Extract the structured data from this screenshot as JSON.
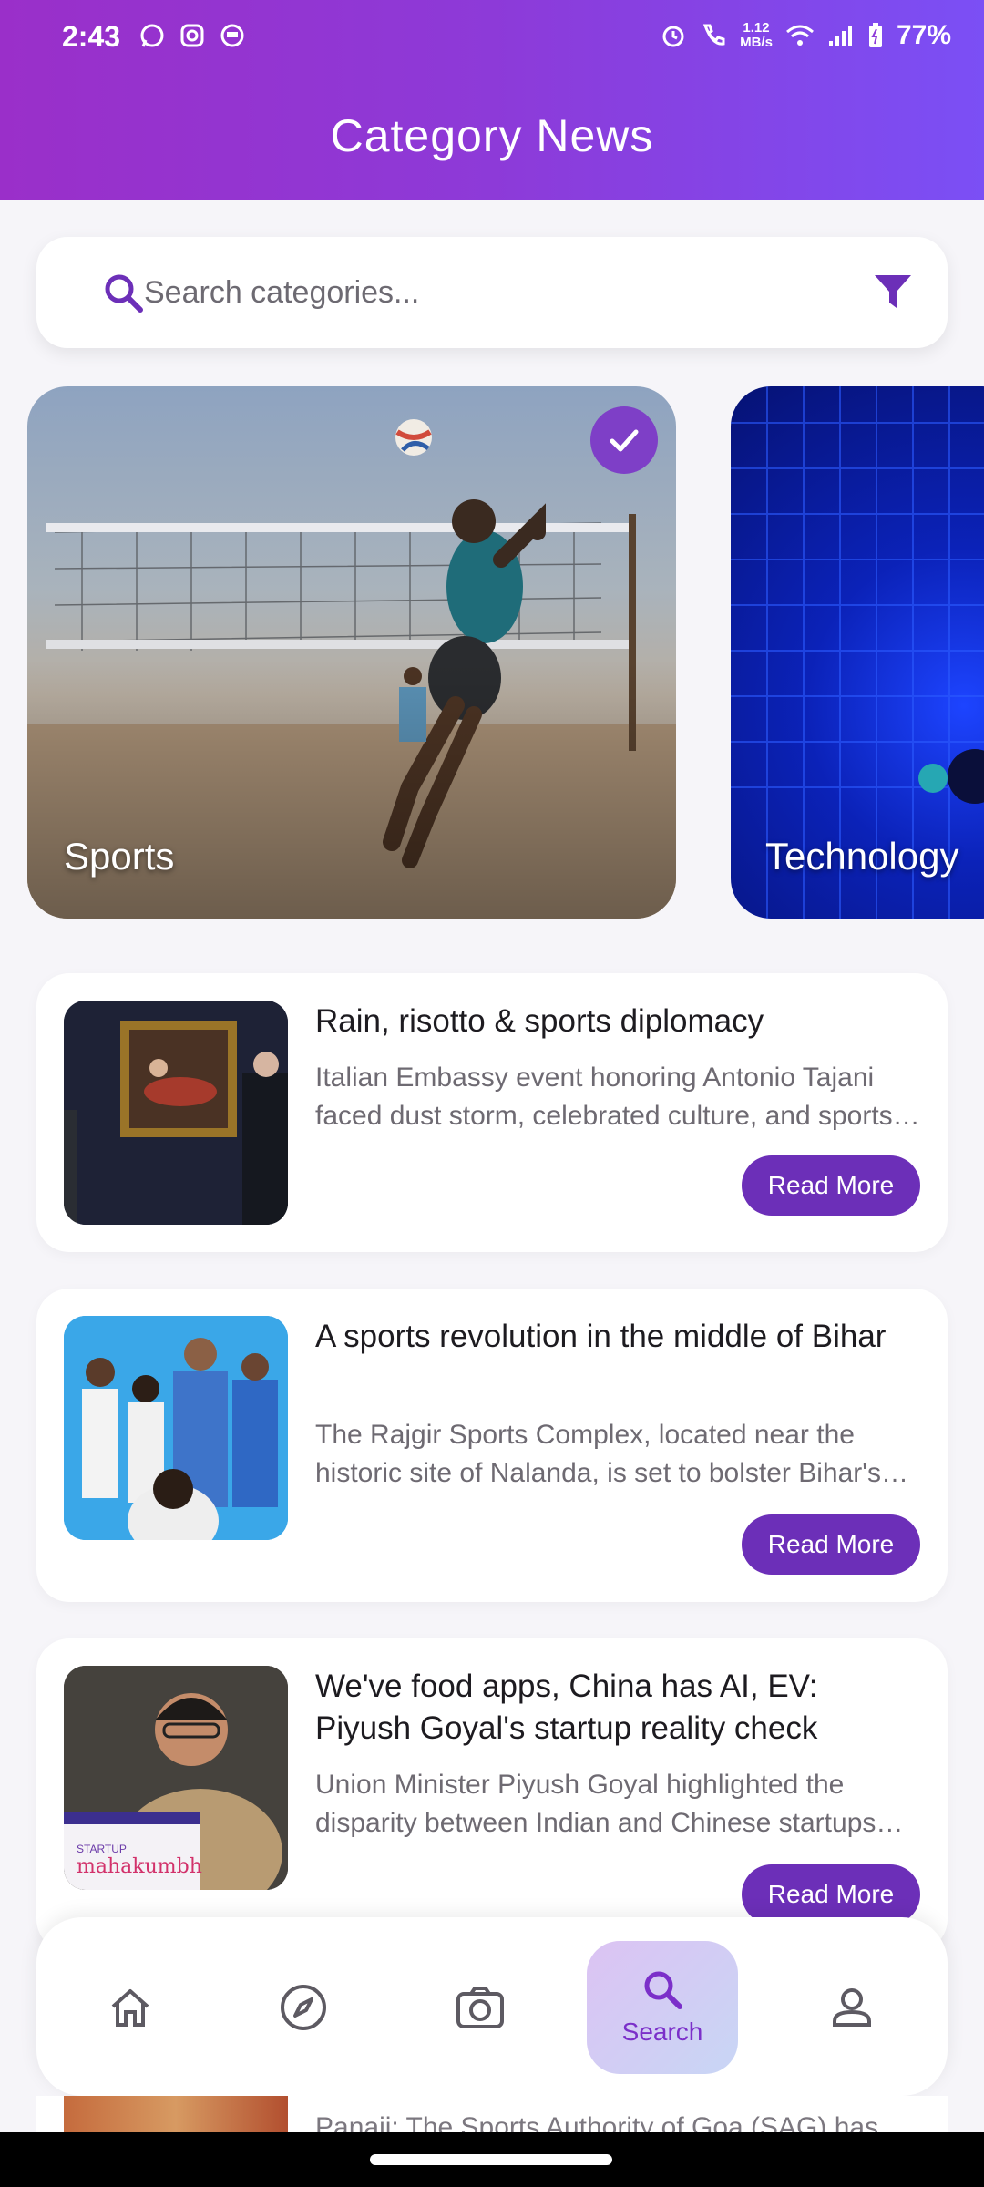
{
  "status_bar": {
    "time": "2:43",
    "speed_top": "1.12",
    "speed_bottom": "MB/s",
    "battery": "77%"
  },
  "header": {
    "title": "Category News"
  },
  "search": {
    "placeholder": "Search categories..."
  },
  "categories": [
    {
      "label": "Sports",
      "selected": true
    },
    {
      "label": "Technology",
      "selected": false
    }
  ],
  "articles": [
    {
      "title": "Rain, risotto & sports diplomacy",
      "description": "Italian Embassy event honoring Antonio Tajani faced dust storm, celebrated culture, and sports diplomacy.",
      "button": "Read More"
    },
    {
      "title": "A sports revolution in the middle of Bihar",
      "description": "The Rajgir Sports Complex, located near the historic site of Nalanda, is set to bolster Bihar's sporting ambitions.",
      "button": "Read More"
    },
    {
      "title": "We've food apps, China has AI, EV: Piyush Goyal's startup reality check",
      "description": "Union Minister Piyush Goyal highlighted the disparity between Indian and Chinese startups and their focus areas.",
      "button": "Read More"
    }
  ],
  "thumbnail_text": {
    "startup": "STARTUP",
    "mahakumbh": "mahakumbh"
  },
  "peek_article": {
    "description": "Panaji: The Sports Authority of Goa (SAG) has"
  },
  "bottom_nav": [
    {
      "icon": "home-icon",
      "label": ""
    },
    {
      "icon": "compass-icon",
      "label": ""
    },
    {
      "icon": "camera-icon",
      "label": ""
    },
    {
      "icon": "search-icon",
      "label": "Search",
      "active": true
    },
    {
      "icon": "person-icon",
      "label": ""
    }
  ],
  "colors": {
    "accent": "#6c2fb8",
    "header_start": "#9a2fc9",
    "header_end": "#7b4ff5"
  }
}
